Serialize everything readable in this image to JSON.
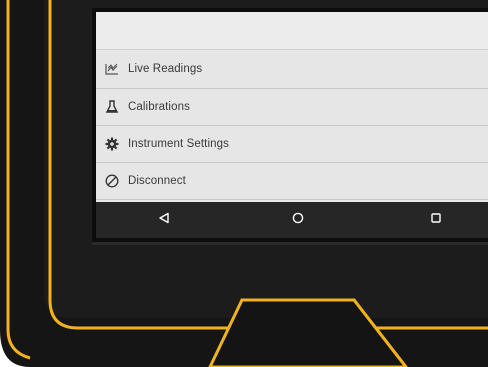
{
  "menu": {
    "items": [
      {
        "label": "Live Readings",
        "icon": "chart-icon"
      },
      {
        "label": "Calibrations",
        "icon": "flask-icon"
      },
      {
        "label": "Instrument Settings",
        "icon": "gear-icon"
      },
      {
        "label": "Disconnect",
        "icon": "disconnect-icon"
      }
    ]
  },
  "navbar": {
    "buttons": [
      "back-icon",
      "home-icon",
      "recents-icon"
    ]
  },
  "colors": {
    "bezel": "#141414",
    "accent": "#f2b21e",
    "menu_bg": "#e6e6e6",
    "navbar_bg": "#262626"
  }
}
